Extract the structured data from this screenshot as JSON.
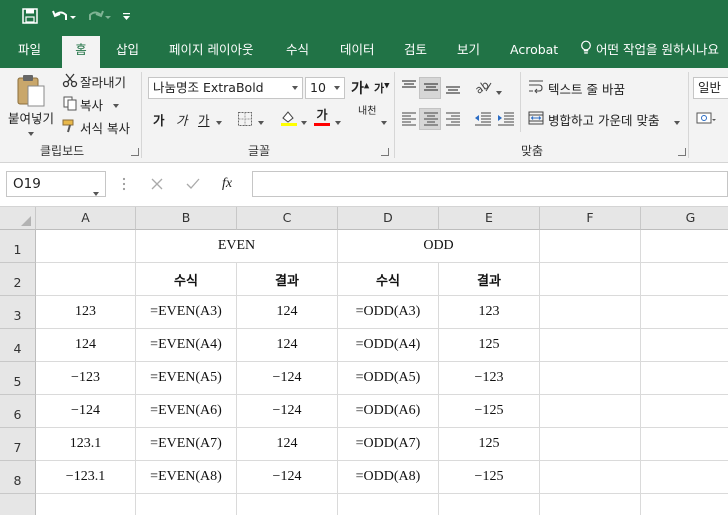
{
  "ribbon_tabs": [
    "파일",
    "홈",
    "삽입",
    "페이지 레이아웃",
    "수식",
    "데이터",
    "검토",
    "보기",
    "Acrobat"
  ],
  "tell_me": "어떤 작업을 원하시나요",
  "clipboard": {
    "paste": "붙여넣기",
    "cut": "잘라내기",
    "copy": "복사",
    "format_painter": "서식 복사",
    "group": "클립보드"
  },
  "font": {
    "name": "나눔명조 ExtraBold",
    "size": "10",
    "group": "글꼴",
    "bold": "가",
    "italic": "가",
    "underline": "가",
    "grow": "가",
    "shrink": "가",
    "font_color": "가",
    "phonetic": "내천"
  },
  "alignment": {
    "wrap": "텍스트 줄 바꿈",
    "merge": "병합하고 가운데 맞춤",
    "group": "맞춤"
  },
  "number": {
    "format": "일반"
  },
  "formula_bar": {
    "name_box": "O19",
    "fx": "fx",
    "formula": ""
  },
  "columns": [
    "A",
    "B",
    "C",
    "D",
    "E",
    "F",
    "G"
  ],
  "rows": [
    "1",
    "2",
    "3",
    "4",
    "5",
    "6",
    "7",
    "8"
  ],
  "sheet": {
    "header1": {
      "even": "EVEN",
      "odd": "ODD"
    },
    "header2": [
      "수식",
      "결과",
      "수식",
      "결과"
    ],
    "data": [
      [
        "123",
        "=EVEN(A3)",
        "124",
        "=ODD(A3)",
        "123"
      ],
      [
        "124",
        "=EVEN(A4)",
        "124",
        "=ODD(A4)",
        "125"
      ],
      [
        "−123",
        "=EVEN(A5)",
        "−124",
        "=ODD(A5)",
        "−123"
      ],
      [
        "−124",
        "=EVEN(A6)",
        "−124",
        "=ODD(A6)",
        "−125"
      ],
      [
        "123.1",
        "=EVEN(A7)",
        "124",
        "=ODD(A7)",
        "125"
      ],
      [
        "−123.1",
        "=EVEN(A8)",
        "−124",
        "=ODD(A8)",
        "−125"
      ]
    ]
  },
  "colors": {
    "excel_green": "#217346",
    "font_color_bar": "#ff0000",
    "highlight_bar": "#ffff00"
  }
}
